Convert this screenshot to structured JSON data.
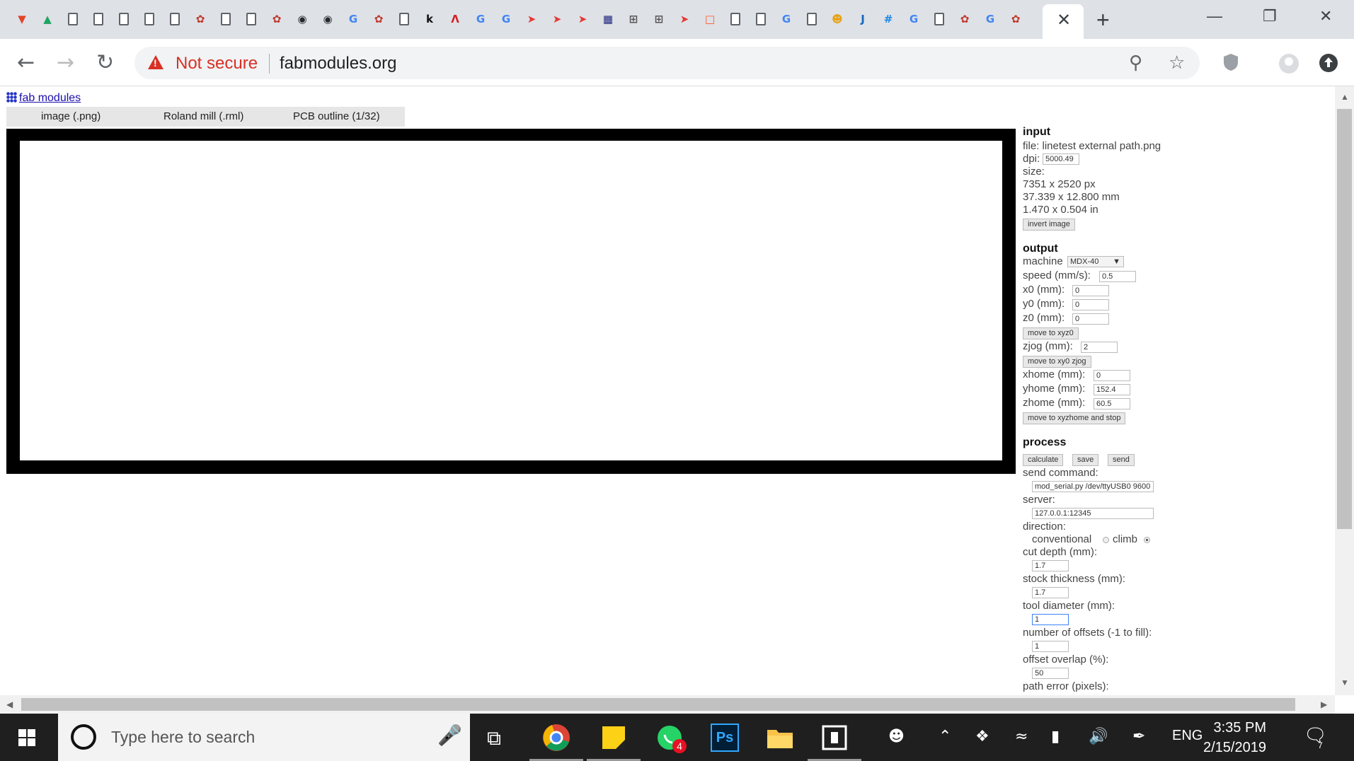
{
  "browser": {
    "active_tab_close": "✕",
    "new_tab": "+",
    "security_label": "Not secure",
    "url": "fabmodules.org",
    "tab_favicons": [
      {
        "name": "gitlab-icon",
        "color": "#e24329",
        "glyph": "▼"
      },
      {
        "name": "google-drive-icon",
        "color": "#1fa463",
        "glyph": "▲"
      },
      {
        "name": "doc-icon",
        "kind": "doc"
      },
      {
        "name": "doc-icon",
        "kind": "doc"
      },
      {
        "name": "doc-icon",
        "kind": "doc"
      },
      {
        "name": "doc-icon",
        "kind": "doc"
      },
      {
        "name": "doc-icon",
        "kind": "doc"
      },
      {
        "name": "fab-icon",
        "color": "#c0392b",
        "glyph": "✿"
      },
      {
        "name": "doc-icon",
        "kind": "doc"
      },
      {
        "name": "doc-icon",
        "kind": "doc"
      },
      {
        "name": "fab-icon",
        "color": "#c0392b",
        "glyph": "✿"
      },
      {
        "name": "github-icon",
        "color": "#24292e",
        "glyph": "◉"
      },
      {
        "name": "github-icon",
        "color": "#24292e",
        "glyph": "◉"
      },
      {
        "name": "google-icon",
        "color": "#4285f4",
        "glyph": "G"
      },
      {
        "name": "fab-icon",
        "color": "#c0392b",
        "glyph": "✿"
      },
      {
        "name": "doc-icon",
        "kind": "doc"
      },
      {
        "name": "k-icon",
        "color": "#111",
        "glyph": "k"
      },
      {
        "name": "autodesk-icon",
        "color": "#d21f26",
        "glyph": "Λ"
      },
      {
        "name": "google-icon",
        "color": "#4285f4",
        "glyph": "G"
      },
      {
        "name": "google-icon",
        "color": "#4285f4",
        "glyph": "G"
      },
      {
        "name": "bookmark-red-icon",
        "color": "#e53935",
        "glyph": "➤"
      },
      {
        "name": "bookmark-red-icon",
        "color": "#e53935",
        "glyph": "➤"
      },
      {
        "name": "bookmark-red-icon",
        "color": "#e53935",
        "glyph": "➤"
      },
      {
        "name": "grid-icon",
        "color": "#1a237e",
        "glyph": "▦"
      },
      {
        "name": "book-icon",
        "color": "#555",
        "glyph": "⊞"
      },
      {
        "name": "book-icon",
        "color": "#555",
        "glyph": "⊞"
      },
      {
        "name": "bookmark-red-icon",
        "color": "#e53935",
        "glyph": "➤"
      },
      {
        "name": "square-orange-icon",
        "color": "#ff5722",
        "glyph": "□"
      },
      {
        "name": "doc-icon",
        "kind": "doc"
      },
      {
        "name": "doc-icon",
        "kind": "doc"
      },
      {
        "name": "google-icon",
        "color": "#4285f4",
        "glyph": "G"
      },
      {
        "name": "doc-icon",
        "kind": "doc"
      },
      {
        "name": "octoprint-icon",
        "color": "#e8a317",
        "glyph": "☻"
      },
      {
        "name": "j-icon",
        "color": "#1565c0",
        "glyph": "J"
      },
      {
        "name": "hash-icon",
        "color": "#1e88e5",
        "glyph": "#"
      },
      {
        "name": "google-icon",
        "color": "#4285f4",
        "glyph": "G"
      },
      {
        "name": "doc-icon",
        "kind": "doc"
      },
      {
        "name": "fab-icon",
        "color": "#c0392b",
        "glyph": "✿"
      },
      {
        "name": "google-icon",
        "color": "#4285f4",
        "glyph": "G"
      },
      {
        "name": "fab-icon",
        "color": "#c0392b",
        "glyph": "✿"
      }
    ]
  },
  "app": {
    "brand": "fab modules",
    "menus": [
      "image (.png)",
      "Roland mill (.rml)",
      "PCB outline (1/32)"
    ],
    "input": {
      "heading": "input",
      "file": "file: linetest external path.png",
      "dpi_label": "dpi:",
      "dpi": "5000.49",
      "size_label": "size:",
      "size_px": "7351 x 2520 px",
      "size_mm": "37.339 x 12.800 mm",
      "size_in": "1.470 x 0.504 in",
      "invert": "invert image"
    },
    "output": {
      "heading": "output",
      "machine_label": "machine",
      "machine": "MDX-40",
      "speed_label": "speed (mm/s):",
      "speed": "0.5",
      "x0_label": "x0 (mm):",
      "x0": "0",
      "y0_label": "y0 (mm):",
      "y0": "0",
      "z0_label": "z0 (mm):",
      "z0": "0",
      "move_xyz0": "move to xyz0",
      "zjog_label": "zjog (mm):",
      "zjog": "2",
      "move_xy0": "move to xy0 zjog",
      "xhome_label": "xhome (mm):",
      "xhome": "0",
      "yhome_label": "yhome (mm):",
      "yhome": "152.4",
      "zhome_label": "zhome (mm):",
      "zhome": "60.5",
      "move_home": "move to xyzhome and stop"
    },
    "process": {
      "heading": "process",
      "calculate": "calculate",
      "save": "save",
      "send": "send",
      "send_command_label": "send command:",
      "send_command": "mod_serial.py /dev/ttyUSB0 9600",
      "server_label": "server:",
      "server": "127.0.0.1:12345",
      "direction_label": "direction:",
      "conventional": "conventional",
      "climb": "climb",
      "cut_depth_label": "cut depth (mm):",
      "cut_depth": "1.7",
      "stock_label": "stock thickness (mm):",
      "stock": "1.7",
      "tool_label": "tool diameter (mm):",
      "tool": "1",
      "offsets_label": "number of offsets (-1 to fill):",
      "offsets": "1",
      "overlap_label": "offset overlap (%):",
      "overlap": "50",
      "path_error_label": "path error (pixels):"
    }
  },
  "taskbar": {
    "search_placeholder": "Type here to search",
    "whatsapp_badge": "4",
    "photoshop": "Ps",
    "language": "ENG",
    "time": "3:35 PM",
    "date": "2/15/2019",
    "notifications": "7"
  },
  "colors": {
    "accent_warning": "#d93025",
    "tabstrip": "#dee1e6",
    "taskbar": "#1f1f1f"
  }
}
